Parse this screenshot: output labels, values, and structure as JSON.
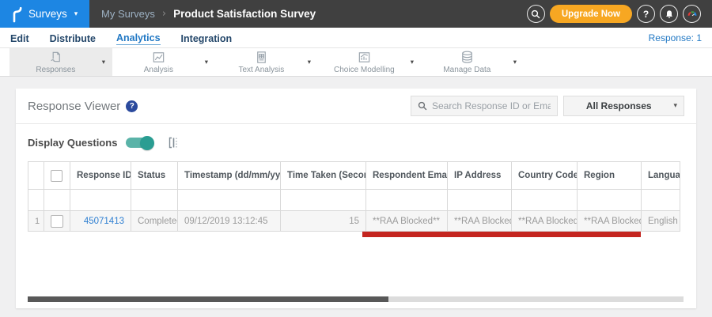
{
  "topbar": {
    "product_menu_label": "Surveys",
    "breadcrumb_parent": "My Surveys",
    "breadcrumb_current": "Product Satisfaction Survey",
    "upgrade_button": "Upgrade Now",
    "help_glyph": "?"
  },
  "nav": {
    "tabs": [
      {
        "label": "Edit"
      },
      {
        "label": "Distribute"
      },
      {
        "label": "Analytics",
        "active": true
      },
      {
        "label": "Integration"
      }
    ],
    "response_count": "Response: 1"
  },
  "ribbon": {
    "items": [
      {
        "label": "Responses",
        "icon": "responses-icon",
        "active": true
      },
      {
        "label": "Analysis",
        "icon": "analysis-icon"
      },
      {
        "label": "Text Analysis",
        "icon": "text-analysis-icon"
      },
      {
        "label": "Choice Modelling",
        "icon": "choice-modelling-icon"
      },
      {
        "label": "Manage Data",
        "icon": "manage-data-icon"
      }
    ]
  },
  "viewer": {
    "title": "Response Viewer",
    "search_placeholder": "Search Response ID or Email",
    "responses_filter_value": "All Responses",
    "display_questions_label": "Display Questions",
    "display_questions_on": true
  },
  "table": {
    "columns": {
      "response_id": "Response ID",
      "status": "Status",
      "timestamp": "Timestamp (dd/mm/yyyy)",
      "time_taken": "Time Taken (Seconds)",
      "email": "Respondent Email",
      "ip": "IP Address",
      "country": "Country Code",
      "region": "Region",
      "language": "Language"
    },
    "rows": [
      {
        "index": "1",
        "response_id": "45071413",
        "status": "Completed",
        "timestamp": "09/12/2019 13:12:45",
        "time_taken": "15",
        "email": "**RAA Blocked**",
        "ip": "**RAA Blocked**",
        "country": "**RAA Blocked**",
        "region": "**RAA Blocked**",
        "language": "English"
      }
    ]
  },
  "glyphs": {
    "caret_down": "▾",
    "sort": "⇅",
    "separator": "›"
  },
  "colors": {
    "brand_blue": "#1d86e3",
    "link_blue": "#2e7fd1",
    "upgrade_orange": "#f7a722",
    "toggle_teal": "#2a9d92",
    "annotation_red": "#c4251f",
    "topbar_gray": "#404040"
  }
}
